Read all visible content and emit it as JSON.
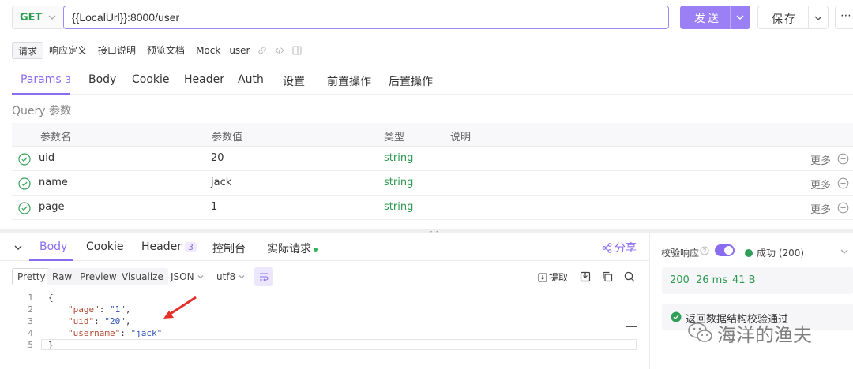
{
  "request": {
    "method": "GET",
    "url": "{{LocalUrl}}:8000/user",
    "send_label": "发送",
    "save_label": "保存",
    "more_label": "⋯"
  },
  "doc_tabs": [
    {
      "label": "请求",
      "active": true
    },
    {
      "label": "响应定义"
    },
    {
      "label": "接口说明"
    },
    {
      "label": "预览文档"
    },
    {
      "label": "Mock"
    }
  ],
  "doc_name": "user",
  "req_tabs": [
    {
      "label": "Params",
      "count": "3",
      "active": true
    },
    {
      "label": "Body"
    },
    {
      "label": "Cookie"
    },
    {
      "label": "Header"
    },
    {
      "label": "Auth"
    },
    {
      "label": "设置"
    },
    {
      "label": "前置操作"
    },
    {
      "label": "后置操作"
    }
  ],
  "query_title": "Query 参数",
  "params_table": {
    "headers": [
      "参数名",
      "参数值",
      "类型",
      "说明"
    ],
    "rows": [
      {
        "name": "uid",
        "value": "20",
        "type": "string",
        "more": "更多"
      },
      {
        "name": "name",
        "value": "jack",
        "type": "string",
        "more": "更多"
      },
      {
        "name": "page",
        "value": "1",
        "type": "string",
        "more": "更多"
      }
    ]
  },
  "response": {
    "tabs": [
      {
        "label": "Body",
        "active": true
      },
      {
        "label": "Cookie"
      },
      {
        "label": "Header",
        "count": "3"
      },
      {
        "label": "控制台"
      },
      {
        "label": "实际请求",
        "dot": true
      }
    ],
    "share_label": "分享",
    "formats": [
      "Pretty",
      "Raw",
      "Preview",
      "Visualize"
    ],
    "format_selected": "Pretty",
    "content_type": "JSON",
    "encoding": "utf8",
    "extract_label": "提取",
    "code_lines": [
      {
        "n": "1",
        "text": "{"
      },
      {
        "n": "2",
        "key": "\"page\"",
        "val": "\"1\"",
        "comma": ","
      },
      {
        "n": "3",
        "key": "\"uid\"",
        "val": "\"20\"",
        "comma": ","
      },
      {
        "n": "4",
        "key": "\"username\"",
        "val": "\"jack\"",
        "comma": ""
      },
      {
        "n": "5",
        "text": "}"
      }
    ]
  },
  "validation": {
    "label": "校验响应",
    "enabled": true,
    "status": "成功 (200)",
    "status_color": "#2f9e58",
    "metrics": {
      "status_code": "200",
      "time": "26 ms",
      "size": "41 B"
    },
    "message": "返回数据结构校验通过"
  },
  "watermark": "海洋的渔夫",
  "colors": {
    "accent": "#8a6cf0",
    "method": "#2b9b4b",
    "type": "#2e9a50"
  }
}
